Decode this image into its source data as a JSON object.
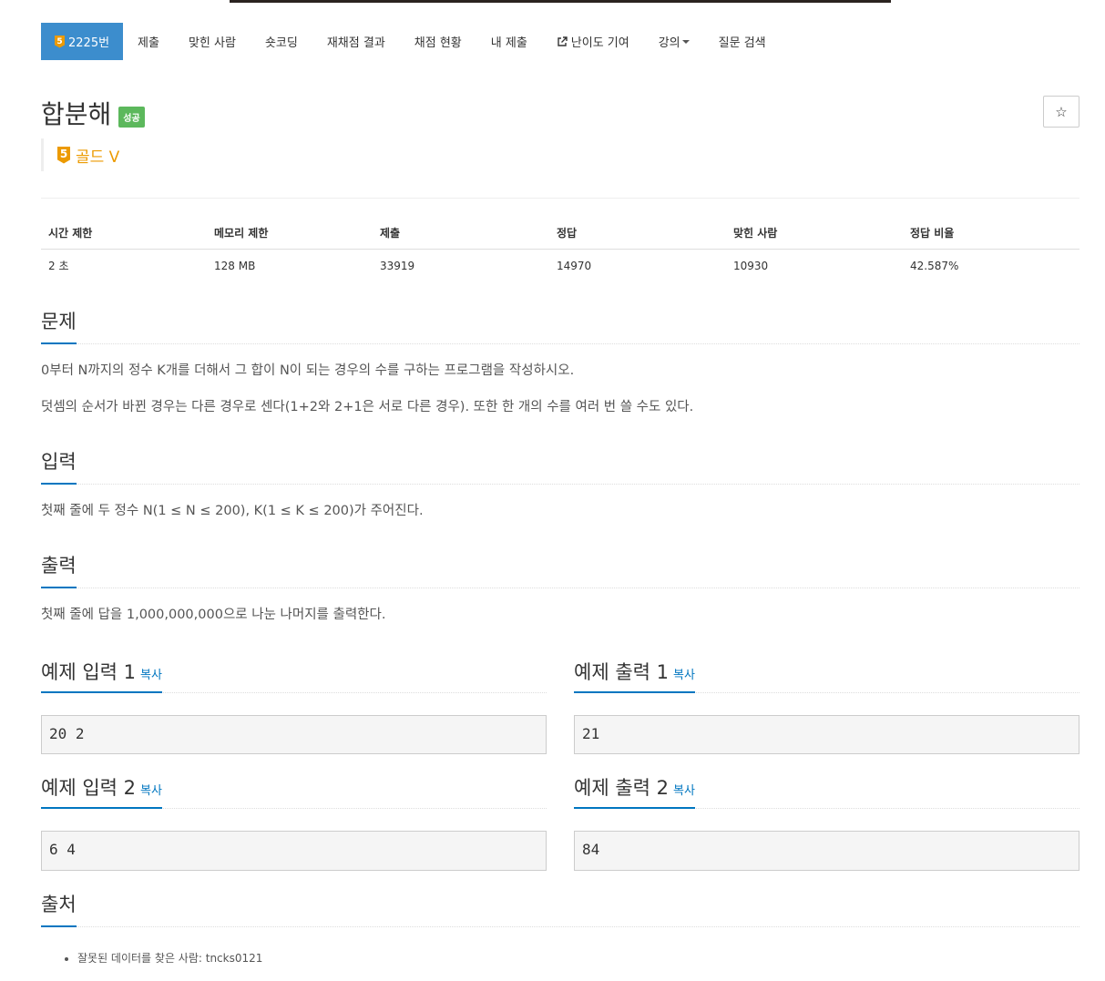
{
  "nav": {
    "problem_id_label": "2225번",
    "tier_digit": "5",
    "items": [
      "제출",
      "맞힌 사람",
      "숏코딩",
      "재채점 결과",
      "채점 현황",
      "내 제출",
      "난이도 기여",
      "강의",
      "질문 검색"
    ]
  },
  "problem": {
    "title": "합분해",
    "result_label": "성공",
    "star_icon": "☆",
    "tier_digit": "5",
    "tier_name": "골드 V"
  },
  "info_table": {
    "headers": [
      "시간 제한",
      "메모리 제한",
      "제출",
      "정답",
      "맞힌 사람",
      "정답 비율"
    ],
    "values": [
      "2 초",
      "128 MB",
      "33919",
      "14970",
      "10930",
      "42.587%"
    ]
  },
  "description": {
    "header": "문제",
    "paragraphs": [
      "0부터 N까지의 정수 K개를 더해서 그 합이 N이 되는 경우의 수를 구하는 프로그램을 작성하시오.",
      "덧셈의 순서가 바뀐 경우는 다른 경우로 센다(1+2와 2+1은 서로 다른 경우). 또한 한 개의 수를 여러 번 쓸 수도 있다."
    ]
  },
  "input": {
    "header": "입력",
    "text": "첫째 줄에 두 정수 N(1 ≤ N ≤ 200), K(1 ≤ K ≤ 200)가 주어진다."
  },
  "output": {
    "header": "출력",
    "text": "첫째 줄에 답을 1,000,000,000으로 나눈 나머지를 출력한다."
  },
  "samples": {
    "copy_label": "복사",
    "input1_title": "예제 입력 1",
    "input1": "20 2",
    "output1_title": "예제 출력 1",
    "output1": "21",
    "input2_title": "예제 입력 2",
    "input2": "6 4",
    "output2_title": "예제 출력 2",
    "output2": "84"
  },
  "source": {
    "header": "출처",
    "items": [
      "잘못된 데이터를 찾은 사람: tncks0121"
    ]
  },
  "colors": {
    "primary": "#3c8dcd",
    "link": "#0076c0",
    "success": "#5cb85c",
    "gold": "#ec9a00"
  }
}
